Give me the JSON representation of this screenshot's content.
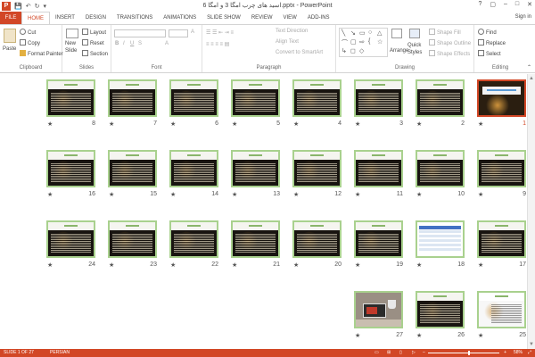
{
  "window": {
    "title": "اسید های چرب امگا 3 و امگا 6.pptx - PowerPoint",
    "help": "?",
    "restore": "▢",
    "minimize": "–",
    "maximize": "□",
    "close": "✕"
  },
  "qat": {
    "save": "💾",
    "undo": "↶",
    "redo": "↻",
    "more": "▾"
  },
  "tabs": [
    "FILE",
    "HOME",
    "INSERT",
    "DESIGN",
    "TRANSITIONS",
    "ANIMATIONS",
    "SLIDE SHOW",
    "REVIEW",
    "VIEW",
    "ADD-INS"
  ],
  "active_tab": "HOME",
  "signin": "Sign in",
  "ribbon": {
    "clipboard": {
      "label": "Clipboard",
      "paste": "Paste",
      "cut": "Cut",
      "copy": "Copy",
      "format_painter": "Format Painter"
    },
    "slides": {
      "label": "Slides",
      "new_slide_1": "New",
      "new_slide_2": "Slide",
      "layout": "Layout",
      "reset": "Reset",
      "section": "Section"
    },
    "font": {
      "label": "Font"
    },
    "paragraph": {
      "label": "Paragraph",
      "text_direction": "Text Direction",
      "align_text": "Align Text",
      "convert": "Convert to SmartArt"
    },
    "drawing": {
      "label": "Drawing",
      "arrange": "Arrange",
      "quick_styles_1": "Quick",
      "quick_styles_2": "Styles",
      "shape_fill": "Shape Fill",
      "shape_outline": "Shape Outline",
      "shape_effects": "Shape Effects"
    },
    "editing": {
      "label": "Editing",
      "find": "Find",
      "replace": "Replace",
      "select": "Select"
    }
  },
  "slides": [
    {
      "n": "1",
      "selected": true,
      "kind": "title"
    },
    {
      "n": "2",
      "kind": "text"
    },
    {
      "n": "3",
      "kind": "text"
    },
    {
      "n": "4",
      "kind": "text"
    },
    {
      "n": "5",
      "kind": "text"
    },
    {
      "n": "6",
      "kind": "text"
    },
    {
      "n": "7",
      "kind": "text"
    },
    {
      "n": "8",
      "kind": "text"
    },
    {
      "n": "9",
      "kind": "text"
    },
    {
      "n": "10",
      "kind": "text"
    },
    {
      "n": "11",
      "kind": "text"
    },
    {
      "n": "12",
      "kind": "text"
    },
    {
      "n": "13",
      "kind": "text"
    },
    {
      "n": "14",
      "kind": "text"
    },
    {
      "n": "15",
      "kind": "text"
    },
    {
      "n": "16",
      "kind": "text"
    },
    {
      "n": "17",
      "kind": "text"
    },
    {
      "n": "18",
      "kind": "table"
    },
    {
      "n": "19",
      "kind": "text"
    },
    {
      "n": "20",
      "kind": "text"
    },
    {
      "n": "21",
      "kind": "text"
    },
    {
      "n": "22",
      "kind": "text"
    },
    {
      "n": "23",
      "kind": "text"
    },
    {
      "n": "24",
      "kind": "text"
    },
    {
      "n": "25",
      "kind": "white"
    },
    {
      "n": "26",
      "kind": "text"
    },
    {
      "n": "27",
      "kind": "photo"
    }
  ],
  "slide_marker": "★",
  "title_slide_text": "اسیدهای چرب امگا 3 و امگا 6",
  "status": {
    "slide": "SLIDE 1 OF 27",
    "language": "PERSIAN",
    "zoom": "58%",
    "zoom_level": 0.58
  }
}
